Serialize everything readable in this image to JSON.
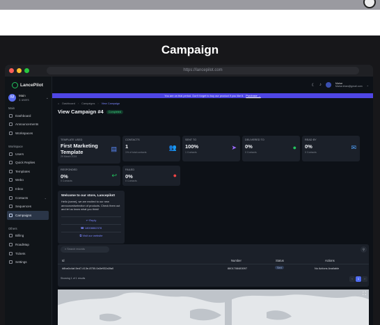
{
  "banner": {
    "title": "Campaign"
  },
  "browser": {
    "url": "https://lancepilot.com"
  },
  "sidebar": {
    "brand": "LancePilot",
    "workspace": {
      "initial": "M",
      "name": "Main",
      "members": "1 users"
    },
    "sections": {
      "main": "Main",
      "workspace": "Workspace",
      "others": "Others"
    },
    "items_main": [
      {
        "label": "Dashboard",
        "icon": "dashboard-icon"
      },
      {
        "label": "Announcements",
        "icon": "megaphone-icon"
      },
      {
        "label": "Workspaces",
        "icon": "folder-icon"
      }
    ],
    "items_workspace": [
      {
        "label": "Users",
        "icon": "users-icon"
      },
      {
        "label": "Quick Replies",
        "icon": "reply-icon"
      },
      {
        "label": "Templates",
        "icon": "template-icon"
      },
      {
        "label": "Webo",
        "icon": "globe-icon"
      },
      {
        "label": "Inbox",
        "icon": "inbox-icon"
      },
      {
        "label": "Contacts",
        "icon": "contacts-icon"
      },
      {
        "label": "Sequences",
        "icon": "sequence-icon"
      },
      {
        "label": "Campaigns",
        "icon": "campaign-icon"
      }
    ],
    "items_others": [
      {
        "label": "Billing",
        "icon": "billing-icon"
      },
      {
        "label": "RoadMap",
        "icon": "map-icon"
      },
      {
        "label": "Tickets",
        "icon": "ticket-icon"
      },
      {
        "label": "Settings",
        "icon": "settings-icon"
      }
    ]
  },
  "header": {
    "user_name": "Mahar",
    "user_email": "Mahar.khan@gmail.com"
  },
  "trial": {
    "text": "You are on trial period. Don't forget to buy our product if you like it.",
    "link": "Purchase →"
  },
  "breadcrumb": {
    "home": "Dashboard",
    "parent": "Campaigns",
    "current": "View Campaign"
  },
  "page": {
    "title": "View Campaign #4",
    "status": "Completed"
  },
  "stats": {
    "template": {
      "label": "Template Used",
      "value": "First Marketing Template",
      "sub": "29 March 2024"
    },
    "contacts": {
      "label": "Contacts",
      "value": "1",
      "sub": "1% of total contacts"
    },
    "sent": {
      "label": "Sent To",
      "value": "100%",
      "sub": "1 Contacts"
    },
    "delivered": {
      "label": "Delivered To",
      "value": "0%",
      "sub": "0 Contacts"
    },
    "read": {
      "label": "Read By",
      "value": "0%",
      "sub": "0 Contacts"
    },
    "responded": {
      "label": "Responded",
      "value": "0%",
      "sub": "0 Contacts"
    },
    "failed": {
      "label": "Failed",
      "value": "0%",
      "sub": "0 Contacts"
    }
  },
  "preview": {
    "title": "Welcome to our store, Lancepilot!",
    "body": "Hello {name}, we are excited to our new announcedselection of products. Check them out and let us know what you think!",
    "btn_reply": "Reply",
    "btn_phone": "18008882378",
    "btn_web": "Visit our website"
  },
  "table": {
    "search_placeholder": "Search records",
    "columns": [
      "Id",
      "Number",
      "Status",
      "Actions"
    ],
    "rows": [
      {
        "id": "#8ba0c4af-5ed7-413e-8750-0a3e932a3fa0",
        "number": "8801708483097",
        "status": "Sent",
        "actions": "No Actions Available"
      }
    ],
    "footer": "Showing 1 of 1 results",
    "page_prev": "‹",
    "page_current": "1",
    "page_next": "›"
  }
}
